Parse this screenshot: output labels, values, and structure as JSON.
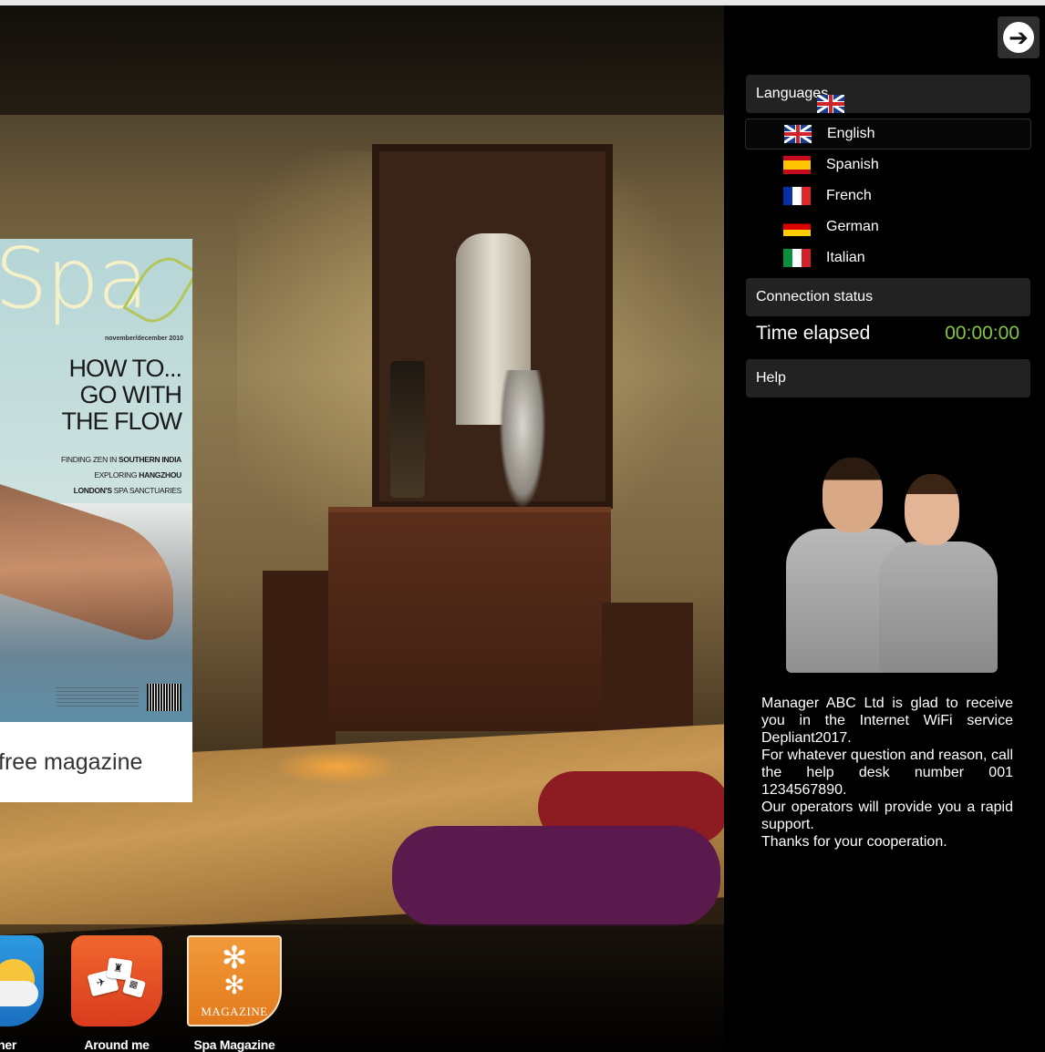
{
  "magazine": {
    "cover_logo": "Spa",
    "cover_date": "november/december 2010",
    "headline_lines": [
      "HOW TO...",
      "GO WITH",
      "THE FLOW"
    ],
    "sub_lines": [
      {
        "pre": "FINDING ZEN IN ",
        "bold": "SOUTHERN INDIA"
      },
      {
        "pre": "EXPLORING ",
        "bold": "HANGZHOU"
      },
      {
        "bold": "LONDON'S",
        "pre": " SPA SANCTUARIES"
      }
    ],
    "caption": "free magazine"
  },
  "dock": {
    "apps": [
      {
        "label": "ther",
        "icon": "weather-icon"
      },
      {
        "label": "Around me",
        "icon": "around-me-icon"
      },
      {
        "label": "Spa Magazine",
        "icon": "spa-magazine-icon",
        "tile_text": "MAGAZINE"
      }
    ]
  },
  "panel": {
    "go_icon": "arrow-right-circle-icon",
    "languages": {
      "title": "Languages",
      "current_flag": "uk-flag-icon",
      "items": [
        {
          "label": "English",
          "flag": "uk-flag-icon",
          "selected": true
        },
        {
          "label": "Spanish",
          "flag": "spain-flag-icon"
        },
        {
          "label": "French",
          "flag": "france-flag-icon"
        },
        {
          "label": "German",
          "flag": "germany-flag-icon"
        },
        {
          "label": "Italian",
          "flag": "italy-flag-icon"
        }
      ]
    },
    "connection": {
      "title": "Connection status",
      "time_label": "Time elapsed",
      "time_value": "00:00:00",
      "time_color": "#86c440"
    },
    "help": {
      "title": "Help"
    },
    "welcome_lines": [
      "Manager ABC Ltd is glad to receive you in the Internet WiFi service Depliant2017.",
      "For whatever question and reason, call the help desk number 001 1234567890.",
      "Our operators will provide you a rapid support.",
      "Thanks for your cooperation."
    ]
  }
}
